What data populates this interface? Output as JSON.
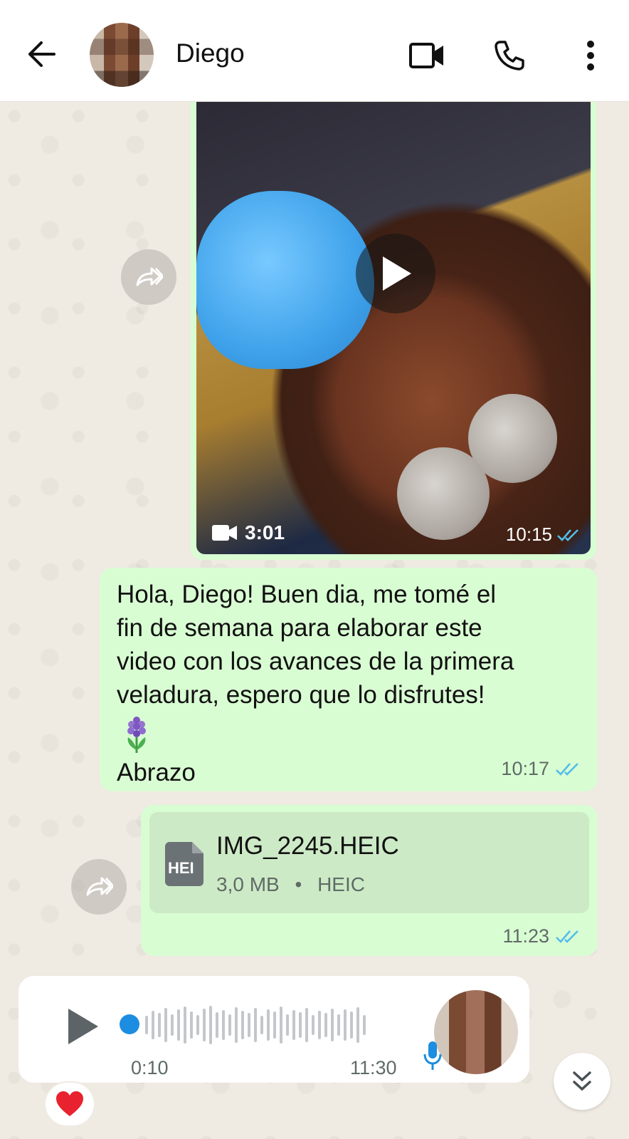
{
  "header": {
    "contact_name": "Diego"
  },
  "video_message": {
    "duration": "3:01",
    "time": "10:15",
    "status": "read"
  },
  "text_message": {
    "lines": [
      "Hola, Diego! Buen dia, me tomé el",
      "fin de semana para elaborar este",
      "video con los avances de la primera",
      "veladura, espero que lo disfrutes!"
    ],
    "closing": "Abrazo",
    "time": "10:17",
    "status": "read"
  },
  "document_message": {
    "file_name": "IMG_2245.HEIC",
    "icon_label": "HEI",
    "size": "3,0 MB",
    "separator": "•",
    "type": "HEIC",
    "time": "11:23",
    "status": "read"
  },
  "voice_message": {
    "duration": "0:10",
    "time": "11:30",
    "progress": 0.0
  },
  "reaction": {
    "emoji": "❤️"
  },
  "colors": {
    "bubble_outgoing": "#d9fdd3",
    "read_ticks": "#53bdeb",
    "voice_accent": "#1c8de0",
    "wallpaper": "#efeae2"
  }
}
